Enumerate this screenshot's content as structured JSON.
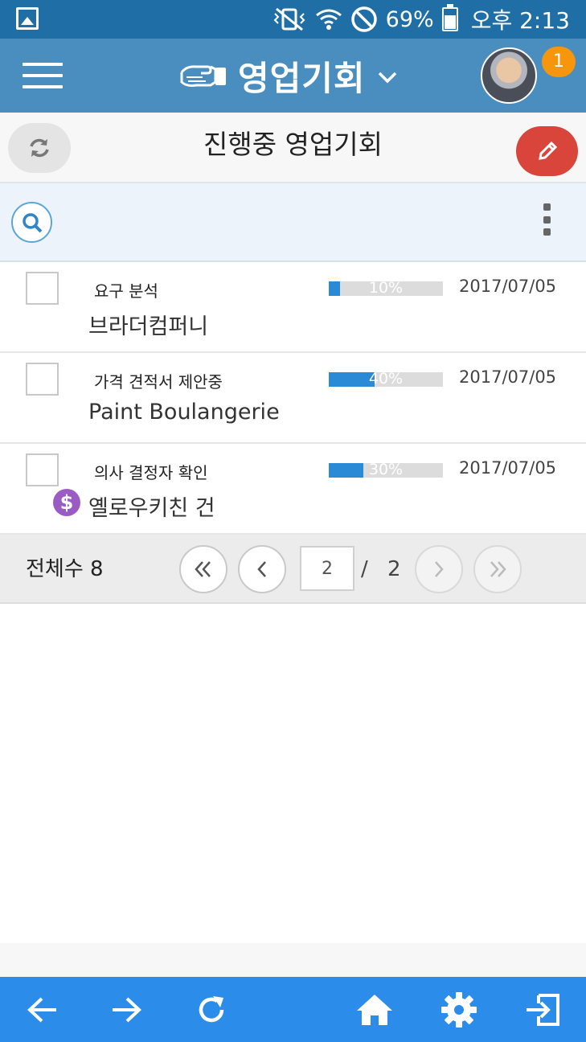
{
  "status_bar": {
    "battery": "69%",
    "time": "오후 2:13",
    "icons": [
      "gallery-icon",
      "vibrate-mute-icon",
      "wifi-icon",
      "do-not-disturb-icon",
      "battery-icon"
    ]
  },
  "app_bar": {
    "title": "영업기회",
    "menu_icon": "hamburger-icon",
    "title_icon": "handshake-icon",
    "dropdown_icon": "chevron-down-icon",
    "notification_count": "1"
  },
  "sub_header": {
    "title": "진행중 영업기회",
    "refresh_icon": "refresh-icon",
    "edit_icon": "pencil-icon"
  },
  "search_bar": {
    "search_icon": "search-icon",
    "more_icon": "kebab-menu-icon"
  },
  "opportunities": [
    {
      "stage": "요구 분석",
      "progress": 10,
      "progress_label": "10%",
      "date": "2017/07/05",
      "name": "브라더컴퍼니",
      "has_dollar_icon": false
    },
    {
      "stage": "가격 견적서 제안중",
      "progress": 40,
      "progress_label": "40%",
      "date": "2017/07/05",
      "name": "Paint Boulangerie",
      "has_dollar_icon": false
    },
    {
      "stage": "의사 결정자 확인",
      "progress": 30,
      "progress_label": "30%",
      "date": "2017/07/05",
      "name": "옐로우키친 건",
      "has_dollar_icon": true
    }
  ],
  "pager": {
    "total_label": "전체수 8",
    "current_page": "2",
    "separator": "/",
    "total_pages": "2",
    "first_icon": "double-chevron-left-icon",
    "prev_icon": "chevron-left-icon",
    "next_icon": "chevron-right-icon",
    "last_icon": "double-chevron-right-icon"
  },
  "colors": {
    "status_bar": "#1f6fa6",
    "app_bar": "#4a8ec0",
    "edit_button": "#d9443b",
    "badge": "#f5960d",
    "progress_fill": "#2b8ad6",
    "dollar_icon": "#9a5bc2",
    "bottom_nav": "#2b8de9"
  },
  "bottom_nav": {
    "icons": [
      "back-arrow-icon",
      "forward-arrow-icon",
      "reload-icon",
      "home-icon",
      "settings-gear-icon",
      "logout-icon"
    ]
  }
}
